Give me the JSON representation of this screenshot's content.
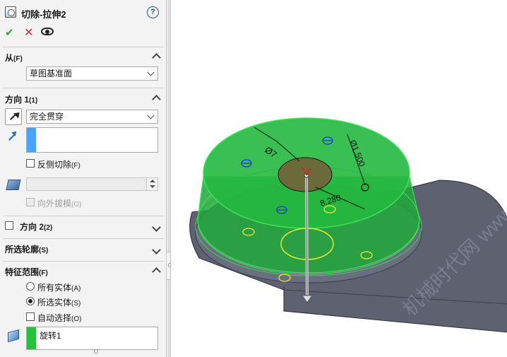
{
  "feature": {
    "title": "切除-拉伸2",
    "help_label": "?"
  },
  "actions": {
    "ok_glyph": "✔",
    "cancel_glyph": "✕"
  },
  "from_group": {
    "title": "从",
    "hotkey": "(F)",
    "selected": "草图基准面"
  },
  "direction1_group": {
    "title": "方向 1",
    "hotkey": "(1)",
    "end_condition": "完全贯穿",
    "flip_side_label": "反侧切除",
    "flip_side_hotkey": "(F)",
    "flip_side_checked": false,
    "draft_outward_label": "向外拔模",
    "draft_outward_hotkey": "(O)",
    "draft_outward_checked": false,
    "direction_list_color": "#4aa3ff"
  },
  "direction2_group": {
    "title": "方向 2",
    "hotkey": "(2)",
    "checked": false
  },
  "contours_group": {
    "title": "所选轮廓",
    "hotkey": "(S)"
  },
  "scope_group": {
    "title": "特征范围",
    "hotkey": "(F)",
    "options": [
      {
        "label": "所有实体",
        "hotkey": "(A)",
        "selected": false
      },
      {
        "label": "所选实体",
        "hotkey": "(S)",
        "selected": true
      }
    ],
    "auto_select_label": "自动选择",
    "auto_select_hotkey": "(O)",
    "auto_select_checked": false,
    "bodies": [
      "旋转1"
    ],
    "bodies_color": "#22c33a"
  },
  "viewport": {
    "dimensions": {
      "d1": "Ø7",
      "d2": "Ø1.500",
      "d3": "8.280"
    },
    "colors": {
      "base": "#5d6170",
      "cut_volume": "#1fa83a",
      "sketch": "#e8e82a",
      "origin": "#1f3fd0"
    },
    "watermark": "机械时代网 www.jxage.com"
  }
}
